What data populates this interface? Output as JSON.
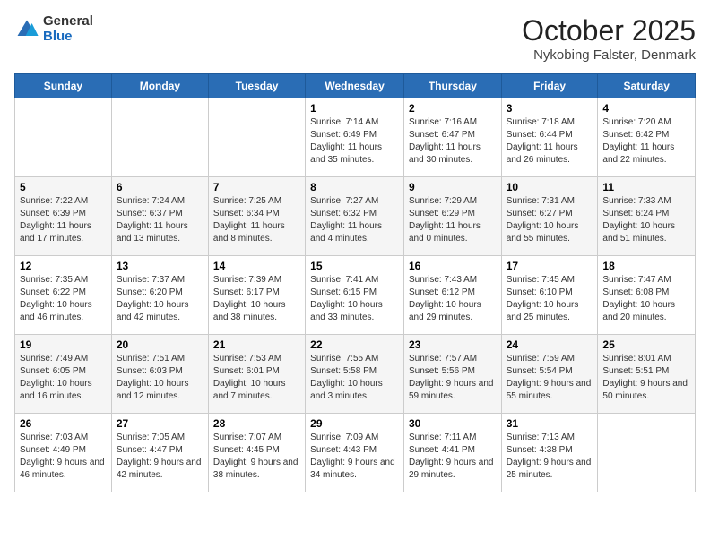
{
  "header": {
    "logo_general": "General",
    "logo_blue": "Blue",
    "month_title": "October 2025",
    "location": "Nykobing Falster, Denmark"
  },
  "days_of_week": [
    "Sunday",
    "Monday",
    "Tuesday",
    "Wednesday",
    "Thursday",
    "Friday",
    "Saturday"
  ],
  "weeks": [
    [
      {
        "day": "",
        "sunrise": "",
        "sunset": "",
        "daylight": ""
      },
      {
        "day": "",
        "sunrise": "",
        "sunset": "",
        "daylight": ""
      },
      {
        "day": "",
        "sunrise": "",
        "sunset": "",
        "daylight": ""
      },
      {
        "day": "1",
        "sunrise": "Sunrise: 7:14 AM",
        "sunset": "Sunset: 6:49 PM",
        "daylight": "Daylight: 11 hours and 35 minutes."
      },
      {
        "day": "2",
        "sunrise": "Sunrise: 7:16 AM",
        "sunset": "Sunset: 6:47 PM",
        "daylight": "Daylight: 11 hours and 30 minutes."
      },
      {
        "day": "3",
        "sunrise": "Sunrise: 7:18 AM",
        "sunset": "Sunset: 6:44 PM",
        "daylight": "Daylight: 11 hours and 26 minutes."
      },
      {
        "day": "4",
        "sunrise": "Sunrise: 7:20 AM",
        "sunset": "Sunset: 6:42 PM",
        "daylight": "Daylight: 11 hours and 22 minutes."
      }
    ],
    [
      {
        "day": "5",
        "sunrise": "Sunrise: 7:22 AM",
        "sunset": "Sunset: 6:39 PM",
        "daylight": "Daylight: 11 hours and 17 minutes."
      },
      {
        "day": "6",
        "sunrise": "Sunrise: 7:24 AM",
        "sunset": "Sunset: 6:37 PM",
        "daylight": "Daylight: 11 hours and 13 minutes."
      },
      {
        "day": "7",
        "sunrise": "Sunrise: 7:25 AM",
        "sunset": "Sunset: 6:34 PM",
        "daylight": "Daylight: 11 hours and 8 minutes."
      },
      {
        "day": "8",
        "sunrise": "Sunrise: 7:27 AM",
        "sunset": "Sunset: 6:32 PM",
        "daylight": "Daylight: 11 hours and 4 minutes."
      },
      {
        "day": "9",
        "sunrise": "Sunrise: 7:29 AM",
        "sunset": "Sunset: 6:29 PM",
        "daylight": "Daylight: 11 hours and 0 minutes."
      },
      {
        "day": "10",
        "sunrise": "Sunrise: 7:31 AM",
        "sunset": "Sunset: 6:27 PM",
        "daylight": "Daylight: 10 hours and 55 minutes."
      },
      {
        "day": "11",
        "sunrise": "Sunrise: 7:33 AM",
        "sunset": "Sunset: 6:24 PM",
        "daylight": "Daylight: 10 hours and 51 minutes."
      }
    ],
    [
      {
        "day": "12",
        "sunrise": "Sunrise: 7:35 AM",
        "sunset": "Sunset: 6:22 PM",
        "daylight": "Daylight: 10 hours and 46 minutes."
      },
      {
        "day": "13",
        "sunrise": "Sunrise: 7:37 AM",
        "sunset": "Sunset: 6:20 PM",
        "daylight": "Daylight: 10 hours and 42 minutes."
      },
      {
        "day": "14",
        "sunrise": "Sunrise: 7:39 AM",
        "sunset": "Sunset: 6:17 PM",
        "daylight": "Daylight: 10 hours and 38 minutes."
      },
      {
        "day": "15",
        "sunrise": "Sunrise: 7:41 AM",
        "sunset": "Sunset: 6:15 PM",
        "daylight": "Daylight: 10 hours and 33 minutes."
      },
      {
        "day": "16",
        "sunrise": "Sunrise: 7:43 AM",
        "sunset": "Sunset: 6:12 PM",
        "daylight": "Daylight: 10 hours and 29 minutes."
      },
      {
        "day": "17",
        "sunrise": "Sunrise: 7:45 AM",
        "sunset": "Sunset: 6:10 PM",
        "daylight": "Daylight: 10 hours and 25 minutes."
      },
      {
        "day": "18",
        "sunrise": "Sunrise: 7:47 AM",
        "sunset": "Sunset: 6:08 PM",
        "daylight": "Daylight: 10 hours and 20 minutes."
      }
    ],
    [
      {
        "day": "19",
        "sunrise": "Sunrise: 7:49 AM",
        "sunset": "Sunset: 6:05 PM",
        "daylight": "Daylight: 10 hours and 16 minutes."
      },
      {
        "day": "20",
        "sunrise": "Sunrise: 7:51 AM",
        "sunset": "Sunset: 6:03 PM",
        "daylight": "Daylight: 10 hours and 12 minutes."
      },
      {
        "day": "21",
        "sunrise": "Sunrise: 7:53 AM",
        "sunset": "Sunset: 6:01 PM",
        "daylight": "Daylight: 10 hours and 7 minutes."
      },
      {
        "day": "22",
        "sunrise": "Sunrise: 7:55 AM",
        "sunset": "Sunset: 5:58 PM",
        "daylight": "Daylight: 10 hours and 3 minutes."
      },
      {
        "day": "23",
        "sunrise": "Sunrise: 7:57 AM",
        "sunset": "Sunset: 5:56 PM",
        "daylight": "Daylight: 9 hours and 59 minutes."
      },
      {
        "day": "24",
        "sunrise": "Sunrise: 7:59 AM",
        "sunset": "Sunset: 5:54 PM",
        "daylight": "Daylight: 9 hours and 55 minutes."
      },
      {
        "day": "25",
        "sunrise": "Sunrise: 8:01 AM",
        "sunset": "Sunset: 5:51 PM",
        "daylight": "Daylight: 9 hours and 50 minutes."
      }
    ],
    [
      {
        "day": "26",
        "sunrise": "Sunrise: 7:03 AM",
        "sunset": "Sunset: 4:49 PM",
        "daylight": "Daylight: 9 hours and 46 minutes."
      },
      {
        "day": "27",
        "sunrise": "Sunrise: 7:05 AM",
        "sunset": "Sunset: 4:47 PM",
        "daylight": "Daylight: 9 hours and 42 minutes."
      },
      {
        "day": "28",
        "sunrise": "Sunrise: 7:07 AM",
        "sunset": "Sunset: 4:45 PM",
        "daylight": "Daylight: 9 hours and 38 minutes."
      },
      {
        "day": "29",
        "sunrise": "Sunrise: 7:09 AM",
        "sunset": "Sunset: 4:43 PM",
        "daylight": "Daylight: 9 hours and 34 minutes."
      },
      {
        "day": "30",
        "sunrise": "Sunrise: 7:11 AM",
        "sunset": "Sunset: 4:41 PM",
        "daylight": "Daylight: 9 hours and 29 minutes."
      },
      {
        "day": "31",
        "sunrise": "Sunrise: 7:13 AM",
        "sunset": "Sunset: 4:38 PM",
        "daylight": "Daylight: 9 hours and 25 minutes."
      },
      {
        "day": "",
        "sunrise": "",
        "sunset": "",
        "daylight": ""
      }
    ]
  ]
}
